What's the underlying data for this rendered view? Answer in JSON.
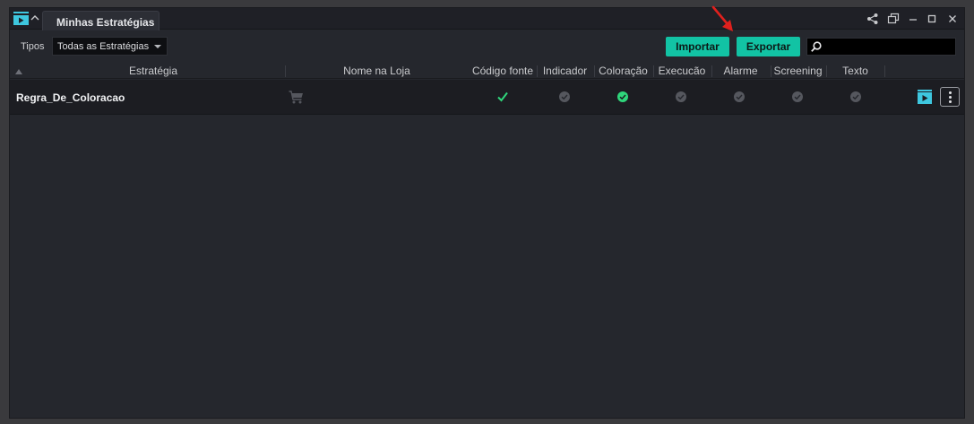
{
  "window": {
    "tab_title": "Minhas Estratégias"
  },
  "toolbar": {
    "types_label": "Tipos",
    "types_selected": "Todas as Estratégias",
    "import_label": "Importar",
    "export_label": "Exportar",
    "search_value": ""
  },
  "table": {
    "headers": {
      "strategy": "Estratégia",
      "store_name": "Nome na Loja",
      "source_code": "Código fonte",
      "indicator": "Indicador",
      "coloring": "Coloração",
      "execution": "Execucão",
      "alarm": "Alarme",
      "screening": "Screening",
      "text": "Texto"
    },
    "rows": [
      {
        "name": "Regra_De_Coloracao",
        "store_name": "",
        "source_code": "check",
        "indicator": "inactive",
        "coloring": "active",
        "execution": "inactive",
        "alarm": "inactive",
        "screening": "inactive",
        "text": "inactive"
      }
    ]
  },
  "icons": {
    "app": "strategy-app-icon",
    "collapse": "chevron-up-icon",
    "share": "share-icon",
    "popout": "popout-icon",
    "minimize": "minimize-icon",
    "maximize": "maximize-icon",
    "close": "close-icon",
    "search": "search-icon",
    "cart": "cart-icon",
    "play": "play-icon",
    "more": "more-vertical-icon"
  },
  "colors": {
    "accent": "#12c3a4",
    "active_green": "#2fd67b",
    "inactive_gray": "#55575e",
    "annotation_red": "#e0201d"
  }
}
